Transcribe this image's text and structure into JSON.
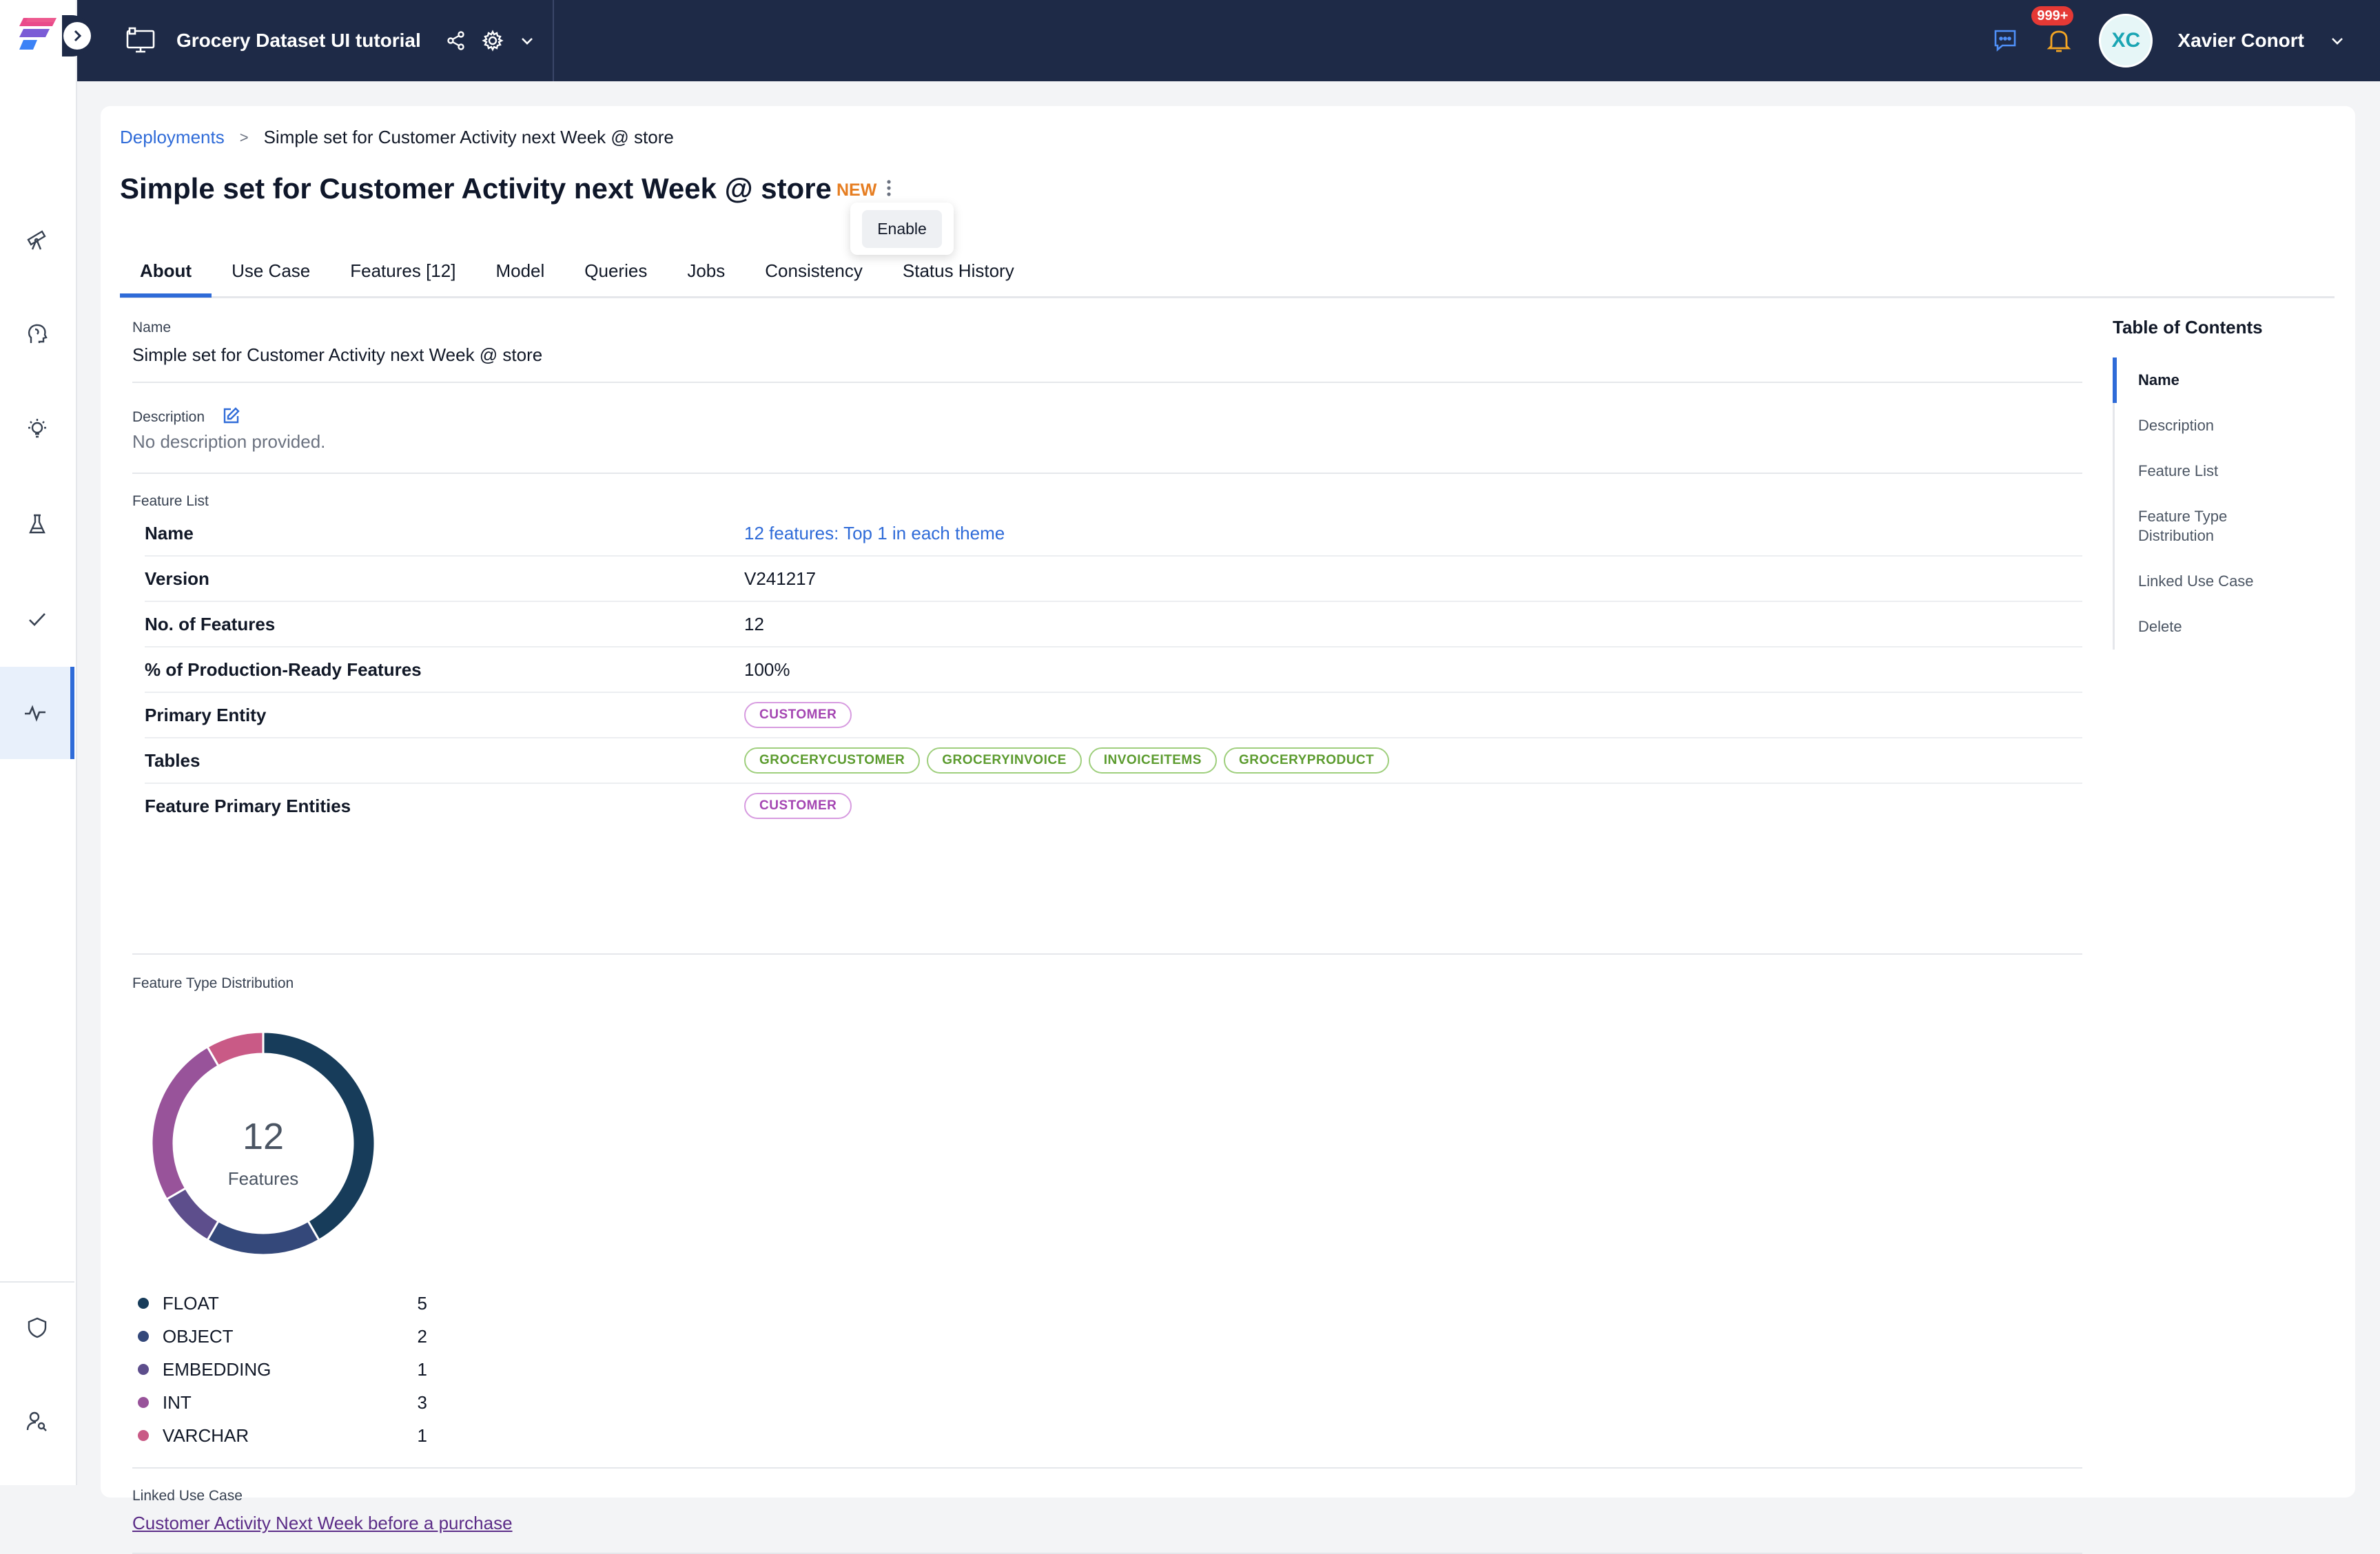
{
  "topbar": {
    "project_title": "Grocery Dataset UI tutorial",
    "notification_count": "999+",
    "user_initials": "XC",
    "user_name": "Xavier Conort"
  },
  "breadcrumb": {
    "root": "Deployments",
    "separator": ">",
    "current": "Simple set for Customer Activity next Week @ store"
  },
  "header": {
    "title": "Simple set for Customer Activity next Week @ store",
    "status": "NEW",
    "menu_action": "Enable"
  },
  "tabs": [
    "About",
    "Use Case",
    "Features [12]",
    "Model",
    "Queries",
    "Jobs",
    "Consistency",
    "Status History"
  ],
  "about": {
    "name_label": "Name",
    "name_value": "Simple set for Customer Activity next Week @ store",
    "description_label": "Description",
    "description_value": "No description provided.",
    "feature_list_label": "Feature List",
    "feature_list": {
      "name_key": "Name",
      "name_value": "12 features: Top 1 in each theme",
      "version_key": "Version",
      "version_value": "V241217",
      "count_key": "No. of Features",
      "count_value": "12",
      "ready_key": "% of Production-Ready Features",
      "ready_value": "100%",
      "primary_entity_key": "Primary Entity",
      "primary_entity": "CUSTOMER",
      "tables_key": "Tables",
      "tables": [
        "GROCERYCUSTOMER",
        "GROCERYINVOICE",
        "INVOICEITEMS",
        "GROCERYPRODUCT"
      ],
      "feature_entities_key": "Feature Primary Entities",
      "feature_entity": "CUSTOMER"
    },
    "distribution_label": "Feature Type Distribution",
    "linked_use_case_label": "Linked Use Case",
    "linked_use_case": "Customer Activity Next Week before a purchase"
  },
  "chart_data": {
    "type": "pie",
    "center_value": "12",
    "center_label": "Features",
    "categories": [
      "FLOAT",
      "OBJECT",
      "EMBEDDING",
      "INT",
      "VARCHAR"
    ],
    "values": [
      5,
      2,
      1,
      3,
      1
    ],
    "colors": [
      "#173c5a",
      "#34487a",
      "#5d4e8c",
      "#98539a",
      "#c95a86"
    ]
  },
  "toc": {
    "title": "Table of Contents",
    "items": [
      "Name",
      "Description",
      "Feature List",
      "Feature Type Distribution",
      "Linked Use Case",
      "Delete"
    ]
  },
  "colors": {
    "topbar": "#1e2a47",
    "accent": "#2f6bd8",
    "status_new": "#e67e22",
    "entity_pill": "#a445b2",
    "table_pill": "#5b9b2e"
  }
}
